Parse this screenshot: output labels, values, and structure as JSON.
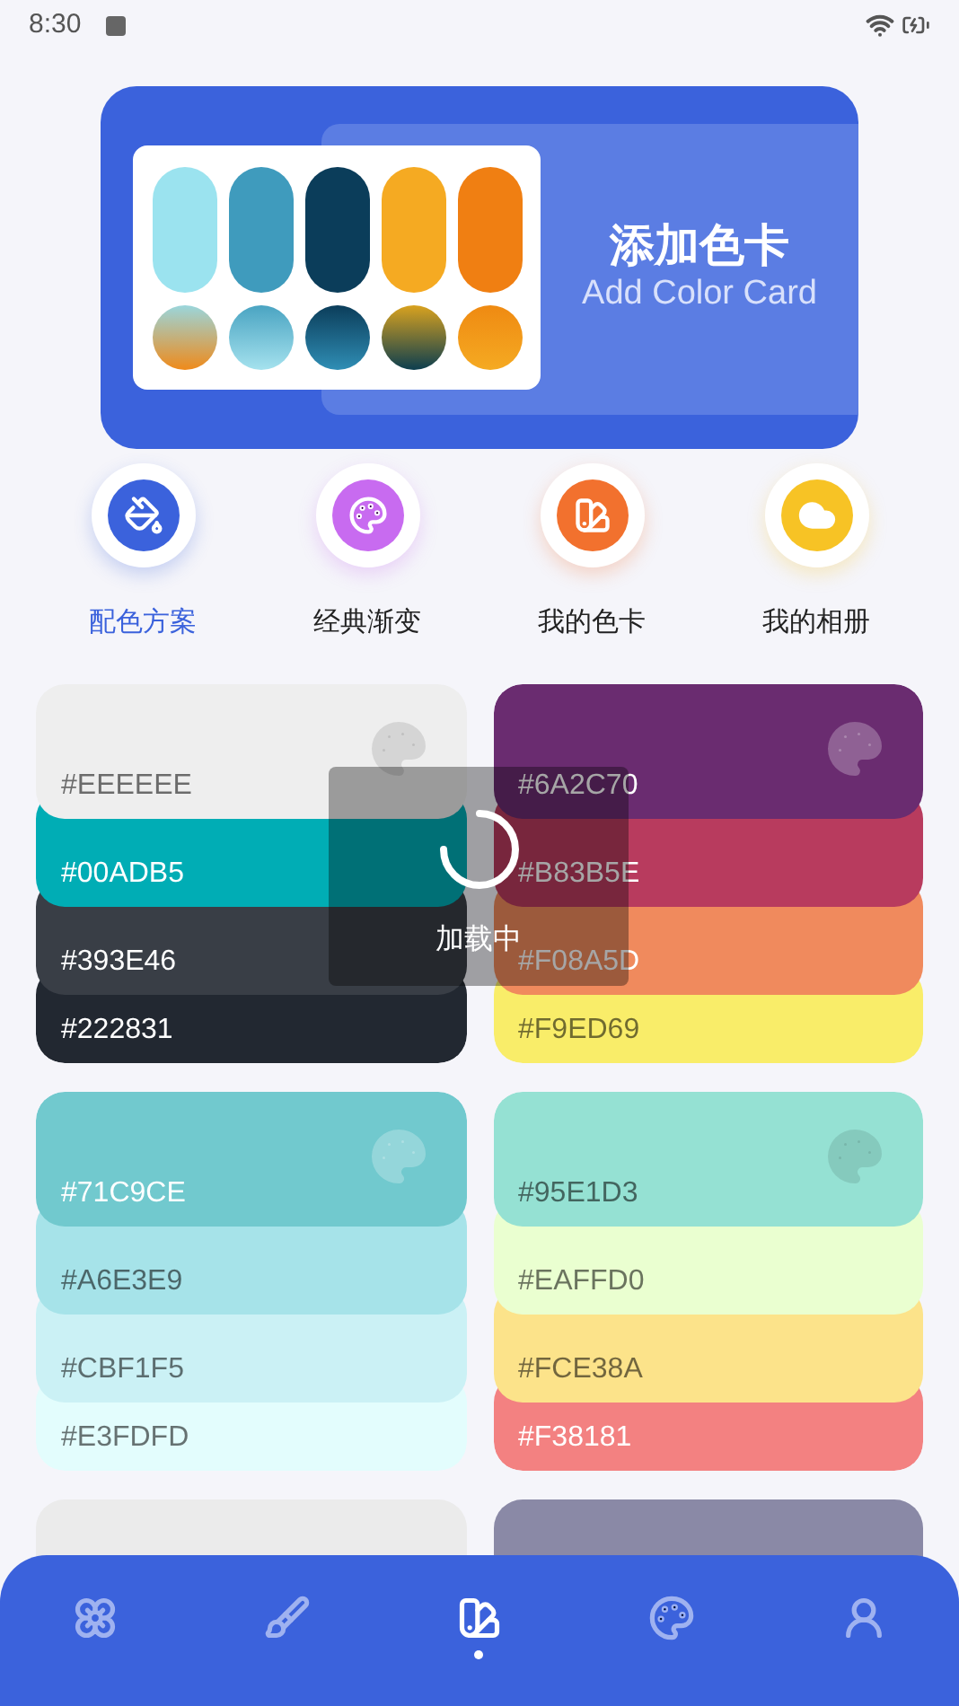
{
  "status_bar": {
    "time": "8:30"
  },
  "banner": {
    "title": "添加色卡",
    "subtitle": "Add Color Card"
  },
  "quick_actions": [
    {
      "label": "配色方案",
      "selected": true,
      "color": "#3b62dc",
      "kind": "bucket"
    },
    {
      "label": "经典渐变",
      "selected": false,
      "color": "#c86bf0",
      "kind": "palette"
    },
    {
      "label": "我的色卡",
      "selected": false,
      "color": "#f2712e",
      "kind": "swatch"
    },
    {
      "label": "我的相册",
      "selected": false,
      "color": "#f7c325",
      "kind": "album"
    }
  ],
  "palettes": [
    {
      "stripes": [
        {
          "label": "#EEEEEE",
          "color": "#eeeeee"
        },
        {
          "label": "#00ADB5",
          "color": "#00adb5"
        },
        {
          "label": "#393E46",
          "color": "#393e46"
        },
        {
          "label": "#222831",
          "color": "#222831"
        }
      ]
    },
    {
      "stripes": [
        {
          "label": "#6A2C70",
          "color": "#6a2c70"
        },
        {
          "label": "#B83B5E",
          "color": "#b83b5e"
        },
        {
          "label": "#F08A5D",
          "color": "#f08a5d"
        },
        {
          "label": "#F9ED69",
          "color": "#f9ed69"
        }
      ]
    },
    {
      "stripes": [
        {
          "label": "#71C9CE",
          "color": "#71c9ce"
        },
        {
          "label": "#A6E3E9",
          "color": "#a6e3e9"
        },
        {
          "label": "#CBF1F5",
          "color": "#cbf1f5"
        },
        {
          "label": "#E3FDFD",
          "color": "#e3fdfd"
        }
      ]
    },
    {
      "stripes": [
        {
          "label": "#95E1D3",
          "color": "#95e1d3"
        },
        {
          "label": "#EAFFD0",
          "color": "#eaffd0"
        },
        {
          "label": "#FCE38A",
          "color": "#fce38a"
        },
        {
          "label": "#F38181",
          "color": "#f38181"
        }
      ]
    }
  ],
  "peek_cards": [
    {
      "color": "#ebebeb"
    },
    {
      "color": "#8a89a6"
    }
  ],
  "loading": {
    "text": "加载中"
  },
  "bottom_nav": [
    {
      "kind": "flower",
      "selected": false
    },
    {
      "kind": "brush",
      "selected": false
    },
    {
      "kind": "swatch",
      "selected": true
    },
    {
      "kind": "palette",
      "selected": false
    },
    {
      "kind": "user",
      "selected": false
    }
  ]
}
